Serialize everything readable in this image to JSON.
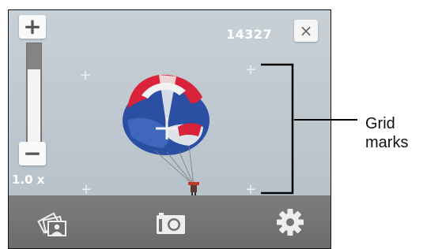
{
  "camera": {
    "shot_counter": "14327",
    "zoom": {
      "in_label": "+",
      "out_label": "−",
      "level_label": "1.0 x",
      "level_fraction": 0.75
    },
    "close_label": "×"
  },
  "toolbar": {
    "gallery_icon": "photo-gallery-icon",
    "shutter_icon": "camera-icon",
    "settings_icon": "gear-icon"
  },
  "annotation": {
    "line1": "Grid",
    "line2": "marks"
  },
  "colors": {
    "sky": "#bcc5cd",
    "toolbar": "#737373",
    "canopy_red": "#d8233a",
    "canopy_blue": "#2a4fa3",
    "canopy_white": "#f2f2f2"
  }
}
